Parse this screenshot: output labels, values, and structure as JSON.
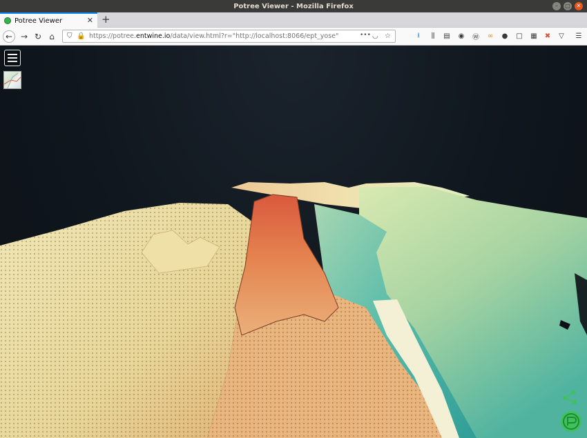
{
  "window": {
    "title": "Potree Viewer - Mozilla Firefox"
  },
  "tabs": [
    {
      "label": "Potree Viewer",
      "active": true
    }
  ],
  "newtab_label": "+",
  "navbar": {
    "url_prefix": "https://potree.",
    "url_host": "entwine.io",
    "url_path": "/data/view.html?r=\"http://localhost:8066/ept_yose\"",
    "page_actions": "•••"
  },
  "viewer": {
    "menu_icon": "hamburger-menu-icon",
    "minimap_icon": "map-icon",
    "logo_icon": "potree-logo-icon"
  },
  "colors": {
    "accent": "#0a84ff",
    "sky": "#0f161d",
    "terrain_high": "#e0724a",
    "terrain_mid": "#e8d8a0",
    "terrain_low": "#2aa89a"
  }
}
